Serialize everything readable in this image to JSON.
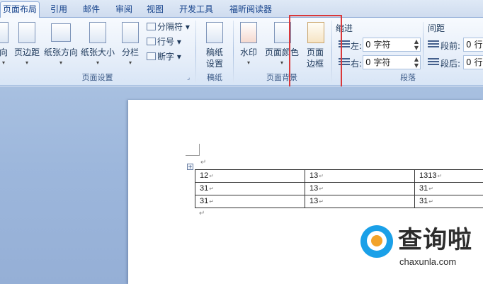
{
  "tabs": [
    {
      "label": "页面布局",
      "active": true
    },
    {
      "label": "引用"
    },
    {
      "label": "邮件"
    },
    {
      "label": "审阅"
    },
    {
      "label": "视图"
    },
    {
      "label": "开发工具"
    },
    {
      "label": "福昕阅读器"
    }
  ],
  "page_setup": {
    "group_label": "页面设置",
    "btn_direction": "向",
    "btn_margins": "页边距",
    "btn_orientation": "纸张方向",
    "btn_size": "纸张大小",
    "btn_columns": "分栏",
    "btn_breaks": "分隔符",
    "btn_line_numbers": "行号",
    "btn_hyphenation": "断字",
    "dropdown_arrow": "▾"
  },
  "manuscript": {
    "group_label": "稿纸",
    "btn_line1": "稿纸",
    "btn_line2": "设置"
  },
  "page_background": {
    "group_label": "页面背景",
    "btn_watermark": "水印",
    "btn_page_color": "页面颜色",
    "btn_border_line1": "页面",
    "btn_border_line2": "边框"
  },
  "paragraph": {
    "group_label": "段落",
    "indent_label": "缩进",
    "left_label": "左:",
    "left_value": "0 字符",
    "right_label": "右:",
    "right_value": "0 字符",
    "spacing_label": "间距",
    "before_label": "段前:",
    "before_value": "0 行",
    "after_label": "段后:",
    "after_value": "0 行",
    "spin_up": "▲",
    "spin_down": "▼"
  },
  "document": {
    "paragraph_mark": "↵",
    "table_handle": "+",
    "table": [
      [
        "12",
        "13",
        "1313"
      ],
      [
        "31",
        "13",
        "31"
      ],
      [
        "31",
        "13",
        "31"
      ]
    ]
  },
  "watermark_logo": {
    "chinese": "查询啦",
    "url": "chaxunla.com",
    "accent_blue": "#1aa0e8",
    "accent_orange": "#f2a32a"
  },
  "colors": {
    "highlight_border": "#d9383a",
    "workspace": "#9db7dc"
  }
}
